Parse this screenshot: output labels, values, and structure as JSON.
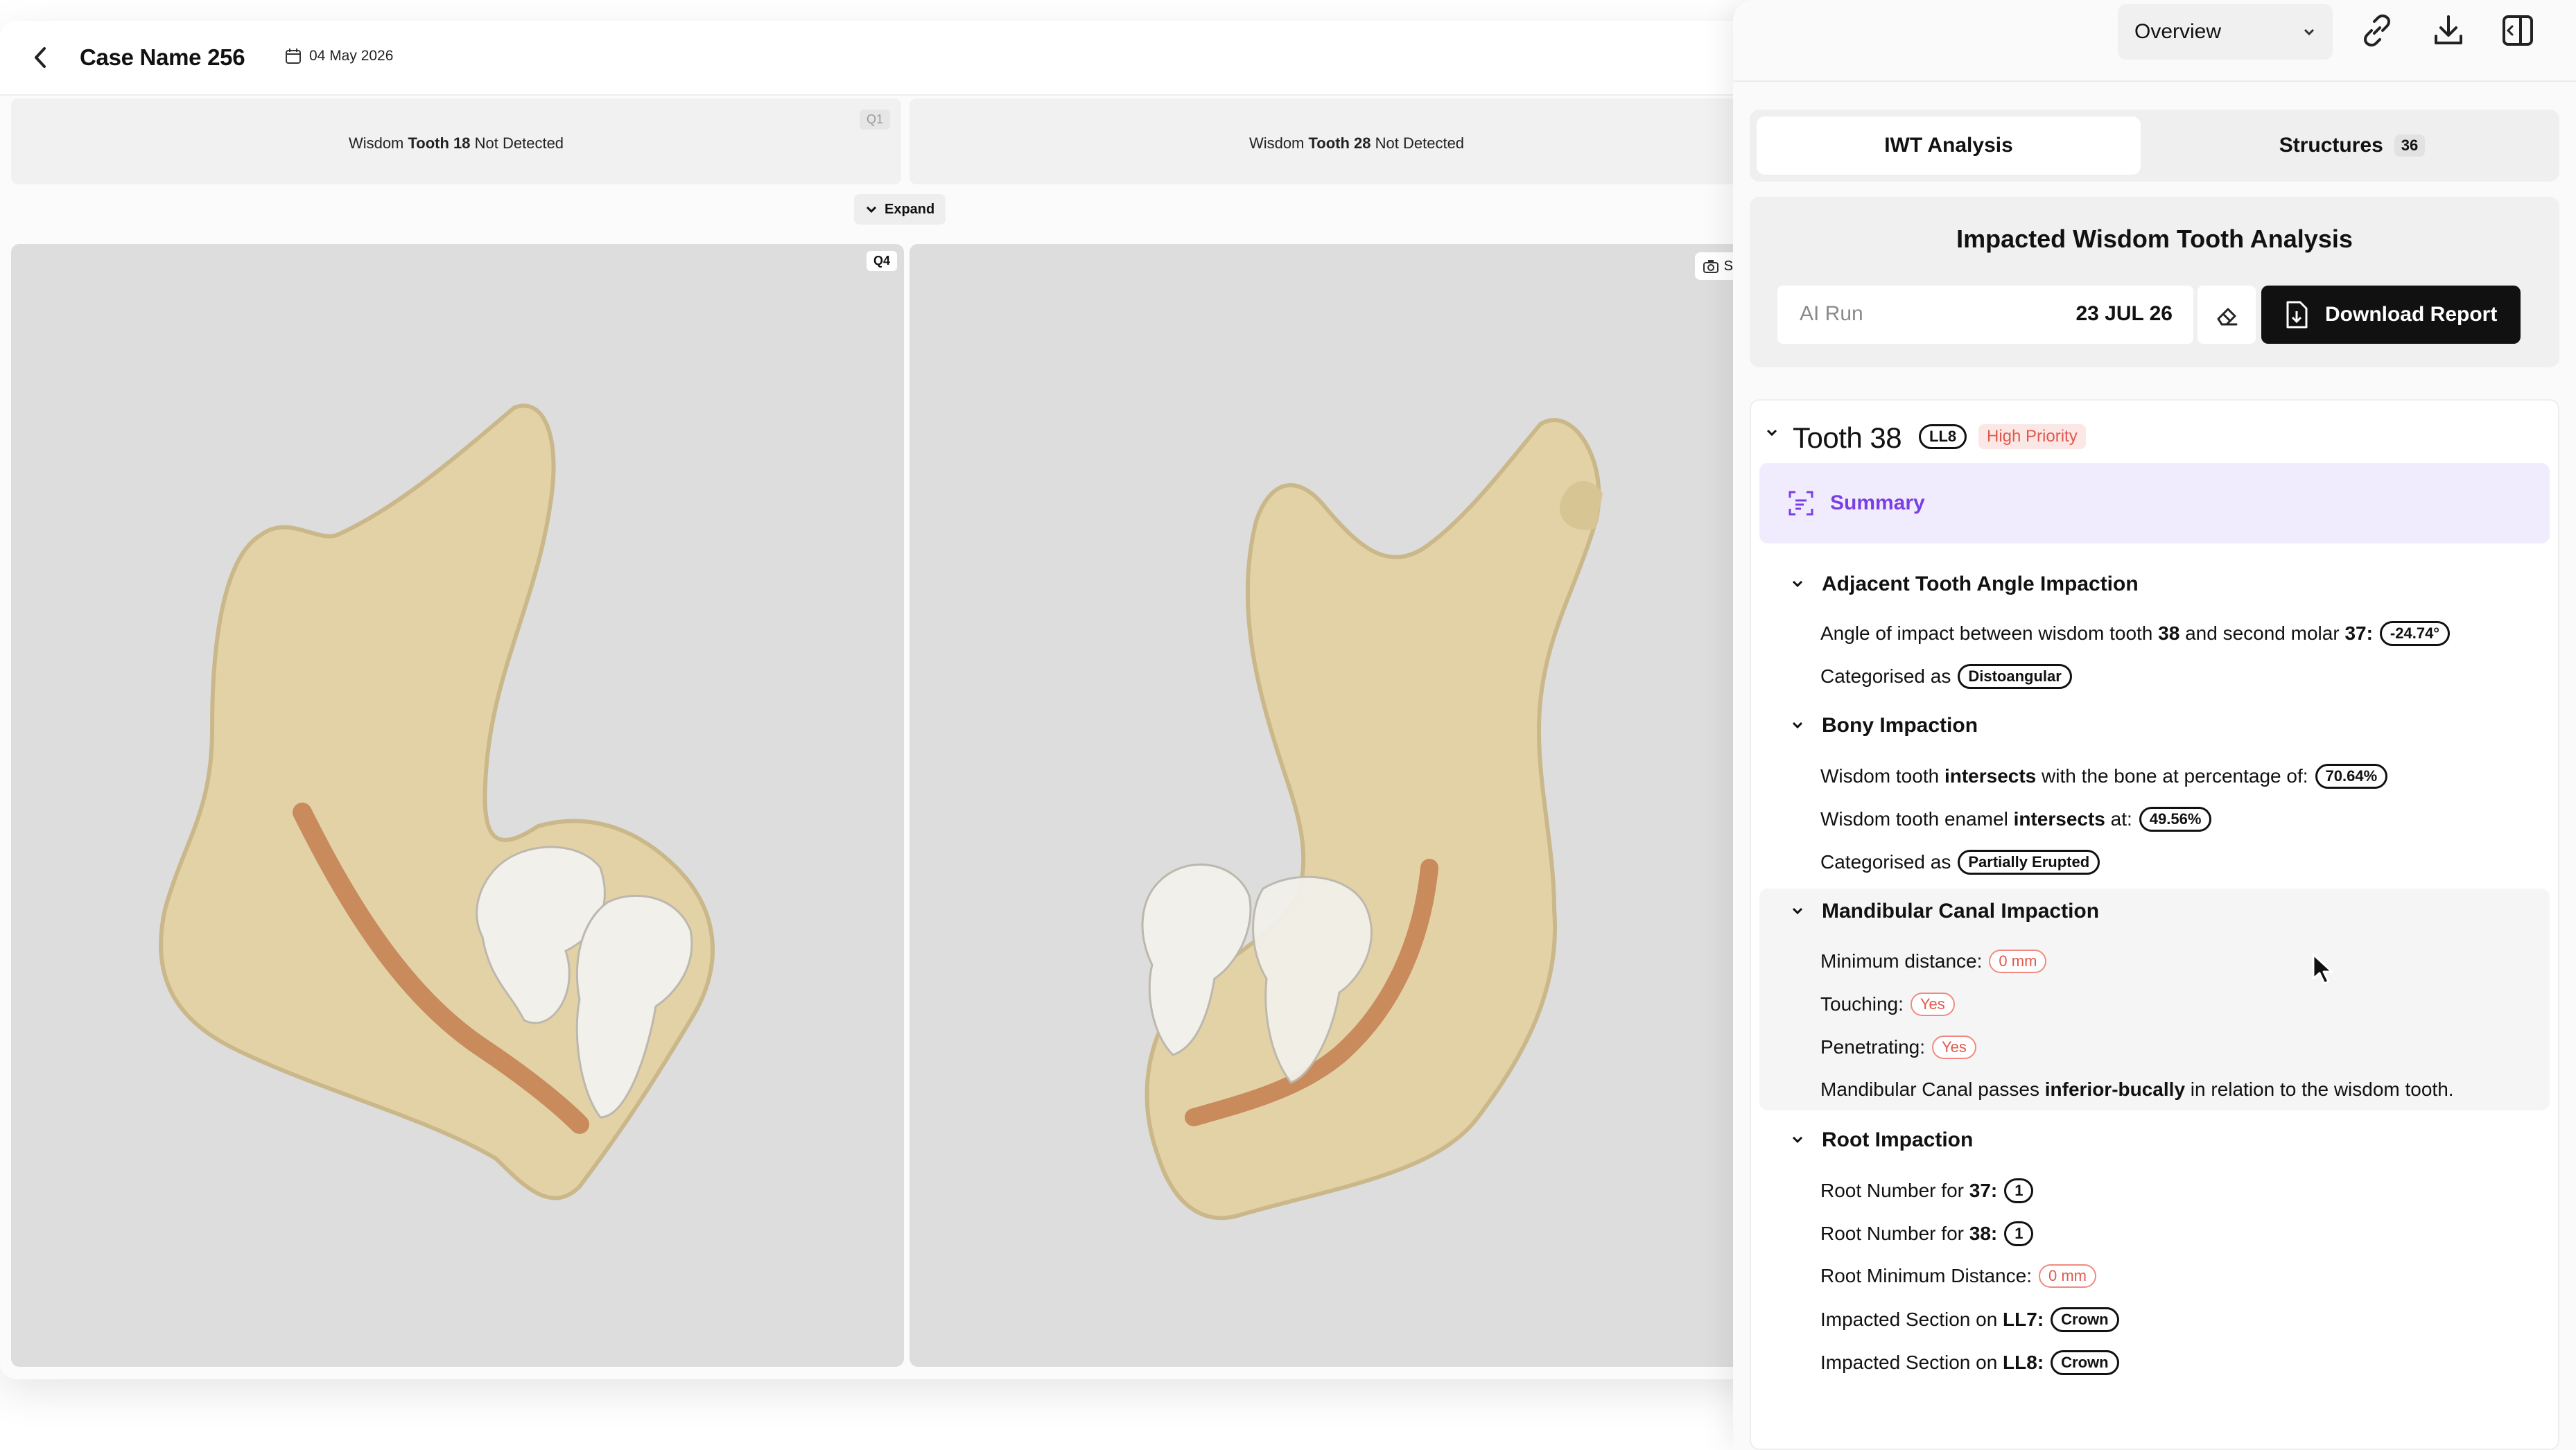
{
  "header": {
    "case_name": "Case Name 256",
    "date": "04 May 2026"
  },
  "quadrants": {
    "q1": {
      "text_pre": "Wisdom ",
      "text_bold": "Tooth 18",
      "text_post": " Not Detected",
      "badge": "Q1"
    },
    "q2": {
      "text_pre": "Wisdom ",
      "text_bold": "Tooth 28",
      "text_post": " Not Detected"
    },
    "expand_label": "Expand"
  },
  "viewers": {
    "left_badge": "Q4",
    "screenshot_label": "Screens"
  },
  "sidebar": {
    "view_select": "Overview",
    "tabs": [
      {
        "label": "IWT Analysis"
      },
      {
        "label": "Structures",
        "count": "36"
      }
    ],
    "analysis": {
      "title": "Impacted Wisdom Tooth Analysis",
      "ai_run_label": "AI Run",
      "ai_run_date": "23 JUL 26",
      "download_label": "Download Report"
    },
    "tooth": {
      "title": "Tooth 38",
      "code": "LL8",
      "priority": "High Priority",
      "summary_label": "Summary"
    },
    "sections": {
      "adjacent": {
        "title": "Adjacent Tooth Angle Impaction",
        "angle_pre": "Angle of impact between wisdom tooth ",
        "angle_tooth": "38",
        "angle_mid": " and second molar ",
        "angle_molar": "37:",
        "angle_value": "-24.74°",
        "cat_label": "Categorised as",
        "cat_value": "Distoangular"
      },
      "bony": {
        "title": "Bony Impaction",
        "r1_pre": "Wisdom tooth ",
        "r1_bold": "intersects",
        "r1_post": " with the bone at percentage of:",
        "r1_value": "70.64%",
        "r2_pre": "Wisdom tooth enamel ",
        "r2_bold": "intersects",
        "r2_post": " at:",
        "r2_value": "49.56%",
        "cat_label": "Categorised as",
        "cat_value": "Partially Erupted"
      },
      "canal": {
        "title": "Mandibular Canal Impaction",
        "min_label": "Minimum distance:",
        "min_value": "0 mm",
        "touch_label": "Touching:",
        "touch_value": "Yes",
        "pen_label": "Penetrating:",
        "pen_value": "Yes",
        "pass_pre": "Mandibular Canal passes ",
        "pass_bold": "inferior-bucally",
        "pass_post": " in relation to the wisdom tooth."
      },
      "root": {
        "title": "Root Impaction",
        "r37_pre": "Root Number for ",
        "r37_bold": "37:",
        "r37_value": "1",
        "r38_pre": "Root Number for ",
        "r38_bold": "38:",
        "r38_value": "1",
        "min_label": "Root Minimum Distance:",
        "min_value": "0 mm",
        "ll7_pre": "Impacted Section on ",
        "ll7_bold": "LL7:",
        "ll7_value": "Crown",
        "ll8_pre": "Impacted Section on ",
        "ll8_bold": "LL8:",
        "ll8_value": "Crown"
      }
    }
  },
  "colors": {
    "bone": "#e3d2a6",
    "canal": "#c98a5c",
    "tooth": "#f2f0ea",
    "accent_purple": "#7a3fe4",
    "alert_red": "#e0584c",
    "viewport_bg": "#dddddd"
  }
}
